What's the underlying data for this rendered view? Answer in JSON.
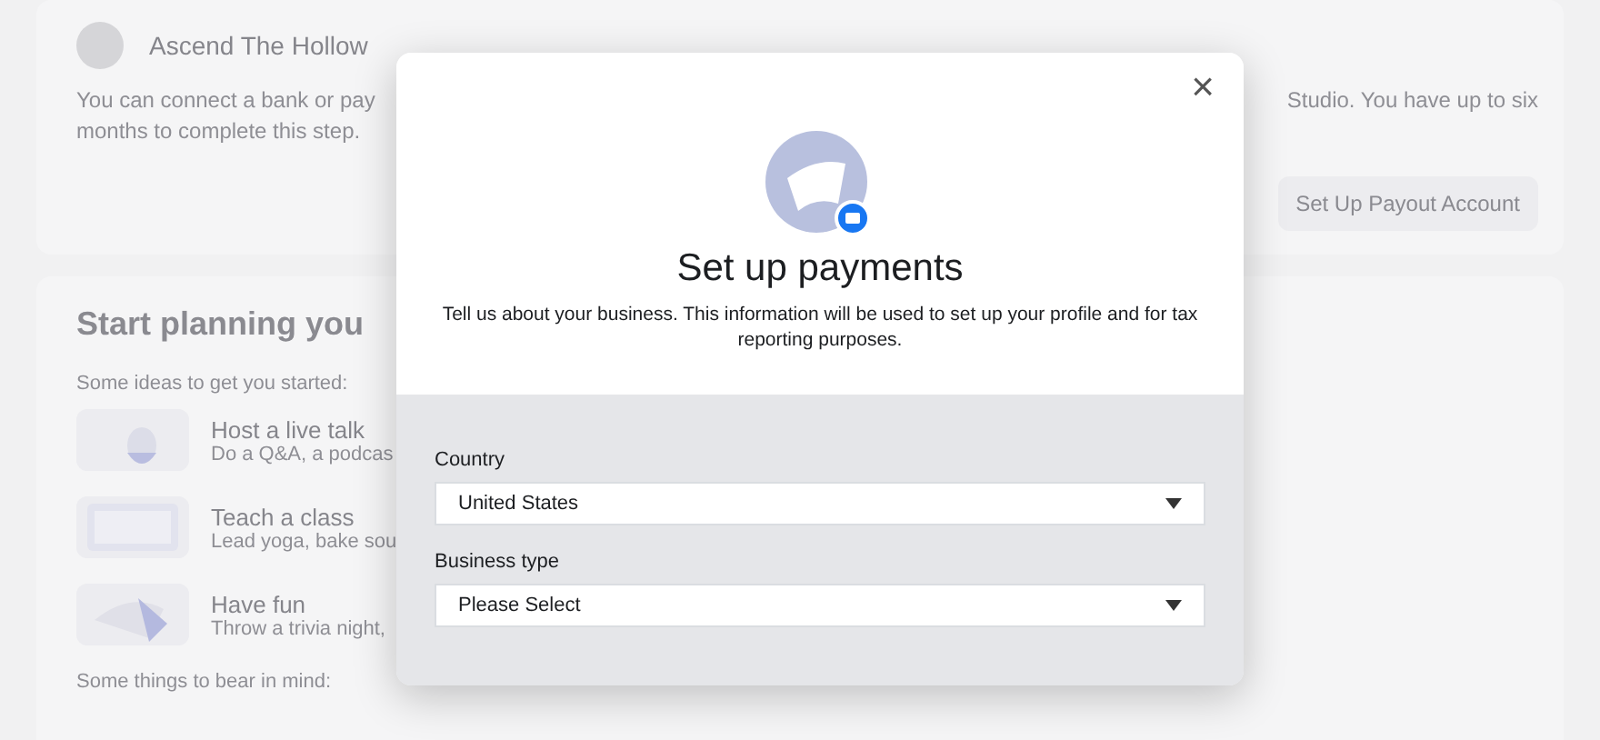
{
  "background": {
    "page_name": "Ascend The Hollow",
    "notice_left": "You can connect a bank or pay",
    "notice_right": "Studio. You have up to six",
    "notice_line2": "months to complete this step.",
    "payout_button": "Set Up Payout Account",
    "heading": "Start planning you",
    "ideas_intro": "Some ideas to get you started:",
    "ideas": [
      {
        "title": "Host a live talk",
        "subtitle": "Do a Q&A, a podcas"
      },
      {
        "title": "Teach a class",
        "subtitle": "Lead yoga, bake sou"
      },
      {
        "title": "Have fun",
        "subtitle": "Throw a trivia night,"
      }
    ],
    "footer_intro": "Some things to bear in mind:"
  },
  "dialog": {
    "close": "×",
    "title": "Set up payments",
    "description": "Tell us about your business. This information will be used to set up your profile and for tax reporting purposes.",
    "fields": [
      {
        "label": "Country",
        "value": "United States"
      },
      {
        "label": "Business type",
        "value": "Please Select"
      }
    ]
  }
}
